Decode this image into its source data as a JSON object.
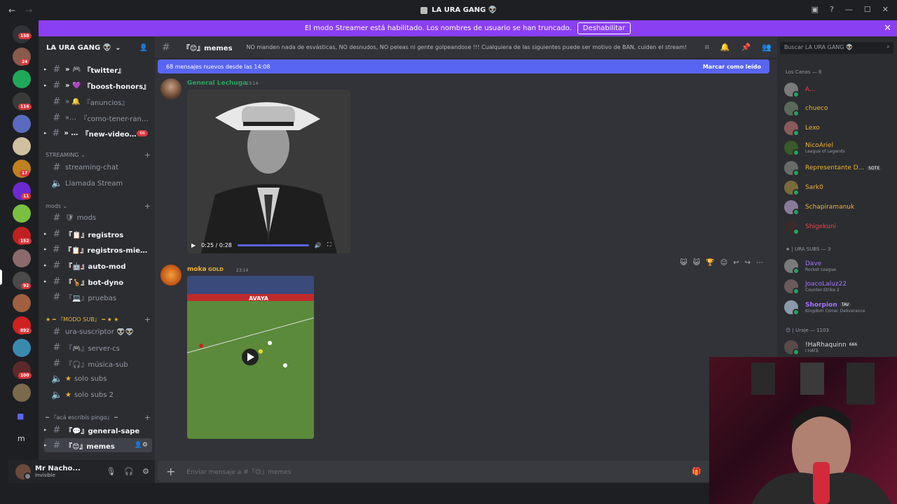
{
  "window": {
    "title": "LA URA GANG 👽",
    "back": "←",
    "forward": "→"
  },
  "banner": {
    "text": "El modo Streamer está habilitado. Los nombres de usuario se han truncado.",
    "button": "Deshabilitar",
    "close": "✕"
  },
  "servers": {
    "badges": [
      "158",
      "24",
      "116",
      "17",
      "11",
      "152",
      "92",
      "892",
      "100"
    ]
  },
  "guild": {
    "name": "LA URA GANG 👽",
    "chevron": "⌄"
  },
  "channels": {
    "items": [
      {
        "name": "『twitter』",
        "prefix": "» 🎮"
      },
      {
        "name": "『boost-honors』",
        "prefix": "» 💜"
      },
      {
        "name": "『anuncios』",
        "prefix": "» 🔔"
      },
      {
        "name": "『como-tener-rang...",
        "prefix": "» ✏"
      },
      {
        "name": "『new-videos』",
        "prefix": "» 🎞",
        "mention": "66"
      },
      {
        "name": "streaming-chat"
      },
      {
        "name": "Llamada Stream"
      },
      {
        "name": "mods",
        "prefix": "🛡"
      },
      {
        "name": "『📋』registros"
      },
      {
        "name": "『📋』registros-miem..."
      },
      {
        "name": "『🤖』auto-mod"
      },
      {
        "name": "『🦒』bot-dyno"
      },
      {
        "name": "『💻』pruebas"
      },
      {
        "name": "ura-suscriptor 👽👽"
      },
      {
        "name": "『🎮』server-cs"
      },
      {
        "name": "『🎧』música-sub"
      },
      {
        "name": "solo subs",
        "prefix": "★"
      },
      {
        "name": "solo subs 2",
        "prefix": "★"
      },
      {
        "name": "『💬』general-sape"
      },
      {
        "name": "『😊』memes"
      }
    ],
    "categories": {
      "streaming": "STREAMING",
      "mods": "mods",
      "modo_sub": "★ ━ 『MODO SUB』 ━ ★ ★",
      "aca": "━ 『acá escribís pingo』 ━"
    }
  },
  "user": {
    "name": "Mr Nacho...",
    "status": "Invisible"
  },
  "chat": {
    "channel_name": "『😊』memes",
    "topic": "NO manden nada de esvásticas, NO desnudos, NO peleas ni gente golpeandose !!! Cualquiera de las siguientes puede ser motivo de BAN, cuiden el stream!",
    "new_messages": "68 mensajes nuevos desde las 14:08",
    "mark_read": "Marcar como leído",
    "composer_placeholder": "Enviar mensaje a #『😊』memes",
    "messages": [
      {
        "author": "General Lechuga",
        "time": "23:14",
        "video_time": "0:25 / 0:28"
      },
      {
        "author": "moka",
        "tag": "GOLD",
        "time": "23:14",
        "ad_text": "AVAYA"
      }
    ]
  },
  "members": {
    "search_placeholder": "Buscar LA URA GANG 👽",
    "groups": [
      {
        "label": "Los Canas — 8"
      },
      {
        "label": "★ | URA SUBS — 3"
      },
      {
        "label": "😊 | Uraje — 1103"
      }
    ],
    "list": [
      {
        "name": "A...",
        "color": "#ed4245"
      },
      {
        "name": "chueco",
        "color": "#f0b232"
      },
      {
        "name": "Lexo",
        "color": "#f0b232"
      },
      {
        "name": "NicoAriel",
        "color": "#f0b232",
        "activity": "League of Legends"
      },
      {
        "name": "Representante D...",
        "color": "#f0b232",
        "tag": "SOTE"
      },
      {
        "name": "Sark0",
        "color": "#f0b232"
      },
      {
        "name": "Schapiramanuk",
        "color": "#f0b232"
      },
      {
        "name": "Shigekuni",
        "color": "#ed4245"
      },
      {
        "name": "Dave",
        "color": "#a672ff",
        "activity": "Rocket League"
      },
      {
        "name": "JoacoLaluz22",
        "color": "#a672ff",
        "activity": "Counter-Strike 2"
      },
      {
        "name": "Shorpion",
        "color": "#a672ff",
        "tag": "TAV",
        "activity": "Kingdom Come: Deliverance"
      },
      {
        "name": "!HaRhaquinn",
        "color": "#dbdee1",
        "tag": "666",
        "activity": "I HATE"
      }
    ]
  },
  "colors": {
    "blurple": "#5865f2",
    "banner": "#8b3ff2",
    "author1": "#23a55a",
    "author2": "#f0b232"
  }
}
